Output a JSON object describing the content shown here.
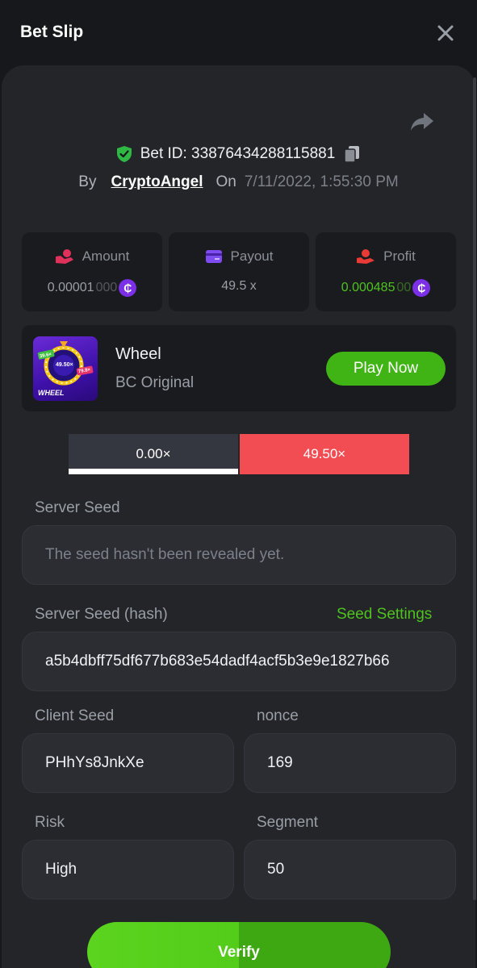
{
  "header": {
    "title": "Bet Slip"
  },
  "bet": {
    "id_text": "Bet ID: 33876434288115881",
    "by_label": "By",
    "user": "CryptoAngel",
    "on_label": "On",
    "date": "7/11/2022, 1:55:30 PM"
  },
  "stats": {
    "amount": {
      "label": "Amount",
      "value_main": "0.00001",
      "value_dim": "000"
    },
    "payout": {
      "label": "Payout",
      "value": "49.5 x"
    },
    "profit": {
      "label": "Profit",
      "value_main": "0.000485",
      "value_dim": "00"
    }
  },
  "coin_symbol": "₵",
  "game": {
    "name": "Wheel",
    "subtitle": "BC Original",
    "play_label": "Play Now",
    "thumb_label": "WHEEL",
    "thumb_tags": [
      "39.6×",
      "49.50×",
      "79.8×"
    ]
  },
  "multipliers": {
    "left": "0.00×",
    "right": "49.50×"
  },
  "server_seed": {
    "label": "Server Seed",
    "value": "The seed hasn't been revealed yet."
  },
  "server_seed_hash": {
    "label": "Server Seed (hash)",
    "link": "Seed Settings",
    "value": "a5b4dbff75df677b683e54dadf4acf5b3e9e1827b66"
  },
  "client_seed": {
    "label": "Client Seed",
    "value": "PHhYs8JnkXe"
  },
  "nonce": {
    "label": "nonce",
    "value": "169"
  },
  "risk": {
    "label": "Risk",
    "value": "High"
  },
  "segment": {
    "label": "Segment",
    "value": "50"
  },
  "verify_label": "Verify",
  "colors": {
    "accent_green": "#4fc21e",
    "red": "#f24d52",
    "purple_coin": "#7b2fe6",
    "panel": "#232529",
    "background": "#17181b"
  },
  "icons": {
    "close": "close-icon",
    "share": "share-icon",
    "verified": "shield-check-icon",
    "copy": "copy-icon",
    "amount": "amount-icon",
    "payout": "card-icon",
    "profit": "profit-icon"
  }
}
